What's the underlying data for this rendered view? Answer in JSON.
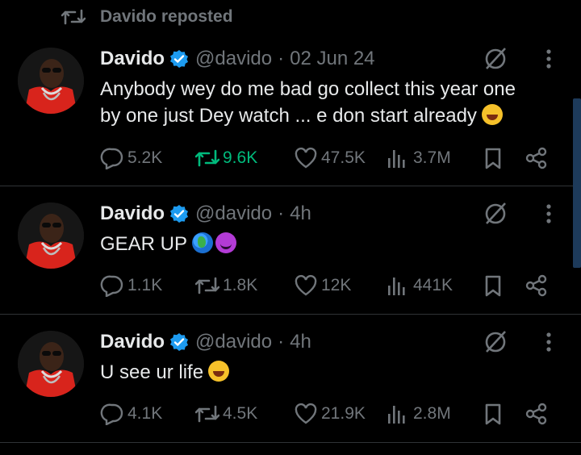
{
  "repost_banner": {
    "text": "Davido reposted",
    "icon": "repost-icon"
  },
  "colors": {
    "background": "#000000",
    "muted": "#71767b",
    "text": "#e7e9ea",
    "repost_active": "#00ba7c",
    "verified": "#1d9bf0"
  },
  "tweets": [
    {
      "name": "Davido",
      "handle": "@davido",
      "separator": "·",
      "time": "02 Jun 24",
      "text_line1": "Anybody wey do me bad go collect this year one",
      "text_line2": "by one just Dey watch ... e don start already",
      "emoji": "laughing-crying-emoji",
      "replies": "5.2K",
      "reposts": "9.6K",
      "reposts_active": true,
      "likes": "47.5K",
      "views": "3.7M"
    },
    {
      "name": "Davido",
      "handle": "@davido",
      "separator": "·",
      "time": "4h",
      "text": "GEAR UP",
      "emojis": [
        "globe-emoji",
        "devil-emoji"
      ],
      "replies": "1.1K",
      "reposts": "1.8K",
      "likes": "12K",
      "views": "441K"
    },
    {
      "name": "Davido",
      "handle": "@davido",
      "separator": "·",
      "time": "4h",
      "text": "U see ur life",
      "emoji": "laughing-crying-emoji",
      "replies": "4.1K",
      "reposts": "4.5K",
      "likes": "21.9K",
      "views": "2.8M"
    }
  ]
}
